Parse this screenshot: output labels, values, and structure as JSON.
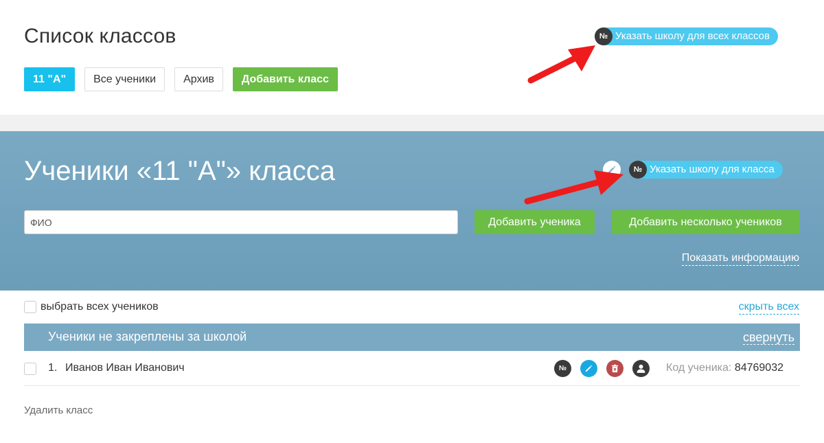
{
  "header": {
    "title": "Список классов",
    "tabs": [
      {
        "label": "11 \"А\"",
        "active": true
      },
      {
        "label": "Все ученики"
      },
      {
        "label": "Архив"
      },
      {
        "label": "Добавить класс",
        "variant": "green"
      }
    ],
    "assign_all_pill": {
      "badge": "№",
      "label": "Указать школу для всех классов"
    }
  },
  "class_panel": {
    "title": "Ученики «11 \"А\"» класса",
    "assign_class_pill": {
      "badge": "№",
      "label": "Указать школу для класса"
    },
    "fio_input": {
      "placeholder": "ФИО",
      "value": ""
    },
    "add_student_label": "Добавить ученика",
    "add_multiple_label": "Добавить несколько учеников",
    "show_info_label": "Показать информацию"
  },
  "list": {
    "select_all_label": "выбрать всех учеников",
    "hide_all_label": "скрыть всех",
    "group": {
      "title": "Ученики не закреплены за школой",
      "collapse_label": "свернуть"
    },
    "students": [
      {
        "num": "1.",
        "name": "Иванов Иван Иванович",
        "code_label": "Код ученика:",
        "code": "84769032"
      }
    ],
    "row_icons": {
      "school_badge": "№"
    },
    "delete_class_label": "Удалить класс"
  },
  "colors": {
    "accent_blue": "#18c0ee",
    "pill_blue": "#4ec9f0",
    "green": "#6bbd46",
    "panel_blue": "#7aa9c3",
    "delete_red": "#b84c4c",
    "arrow_red": "#ee1c1c"
  }
}
